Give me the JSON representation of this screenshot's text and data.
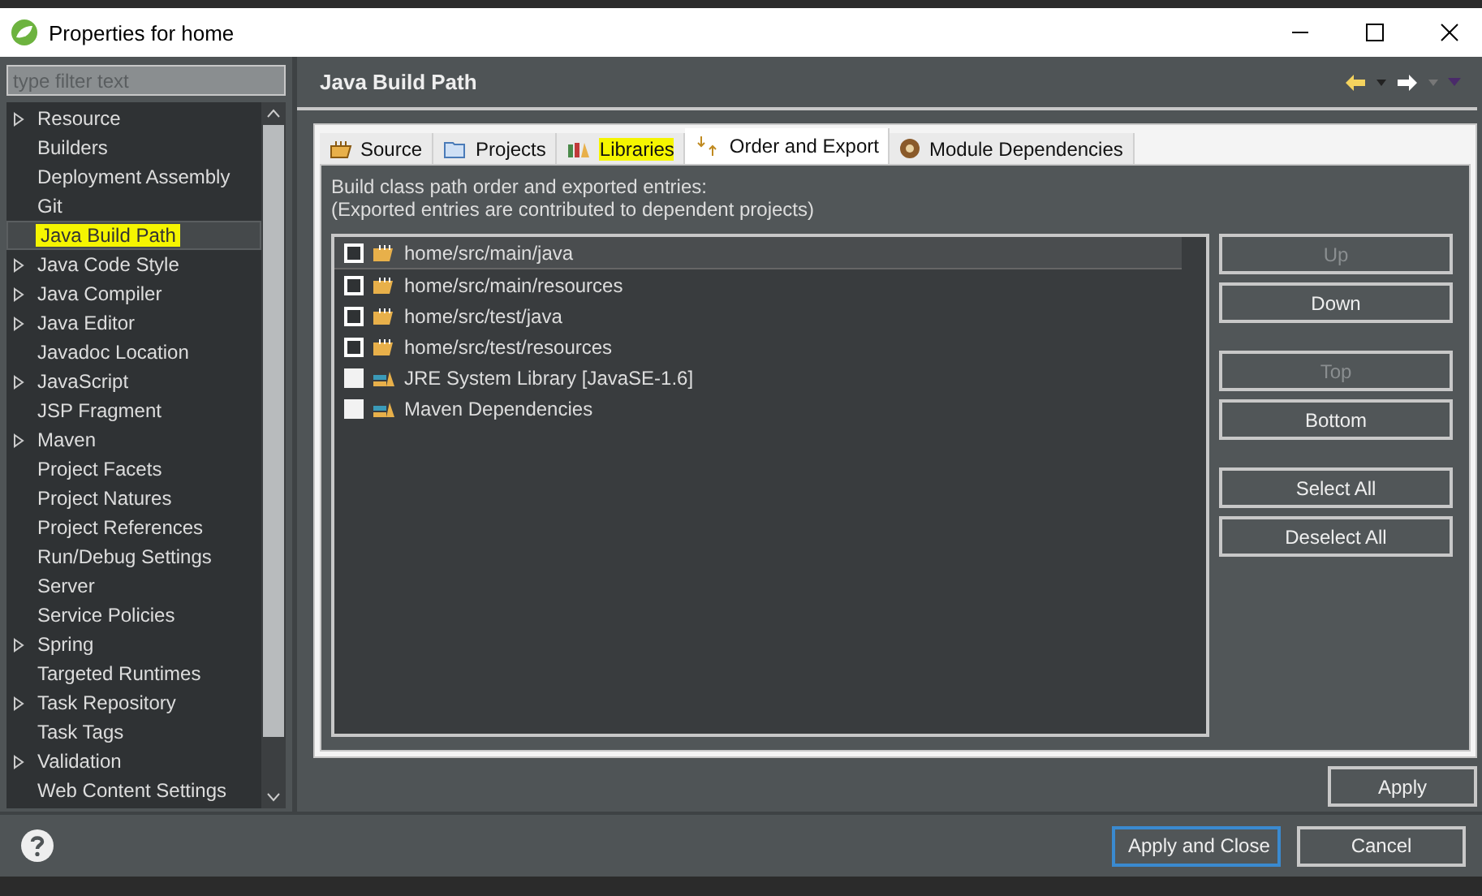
{
  "window": {
    "title": "Properties for home"
  },
  "filter": {
    "placeholder": "type filter text"
  },
  "tree": [
    {
      "label": "Resource",
      "expandable": true,
      "selected": false,
      "highlighted": false
    },
    {
      "label": "Builders",
      "expandable": false,
      "selected": false,
      "highlighted": false
    },
    {
      "label": "Deployment Assembly",
      "expandable": false,
      "selected": false,
      "highlighted": false
    },
    {
      "label": "Git",
      "expandable": false,
      "selected": false,
      "highlighted": false
    },
    {
      "label": "Java Build Path",
      "expandable": false,
      "selected": true,
      "highlighted": true
    },
    {
      "label": "Java Code Style",
      "expandable": true,
      "selected": false,
      "highlighted": false
    },
    {
      "label": "Java Compiler",
      "expandable": true,
      "selected": false,
      "highlighted": false
    },
    {
      "label": "Java Editor",
      "expandable": true,
      "selected": false,
      "highlighted": false
    },
    {
      "label": "Javadoc Location",
      "expandable": false,
      "selected": false,
      "highlighted": false
    },
    {
      "label": "JavaScript",
      "expandable": true,
      "selected": false,
      "highlighted": false
    },
    {
      "label": "JSP Fragment",
      "expandable": false,
      "selected": false,
      "highlighted": false
    },
    {
      "label": "Maven",
      "expandable": true,
      "selected": false,
      "highlighted": false
    },
    {
      "label": "Project Facets",
      "expandable": false,
      "selected": false,
      "highlighted": false
    },
    {
      "label": "Project Natures",
      "expandable": false,
      "selected": false,
      "highlighted": false
    },
    {
      "label": "Project References",
      "expandable": false,
      "selected": false,
      "highlighted": false
    },
    {
      "label": "Run/Debug Settings",
      "expandable": false,
      "selected": false,
      "highlighted": false
    },
    {
      "label": "Server",
      "expandable": false,
      "selected": false,
      "highlighted": false
    },
    {
      "label": "Service Policies",
      "expandable": false,
      "selected": false,
      "highlighted": false
    },
    {
      "label": "Spring",
      "expandable": true,
      "selected": false,
      "highlighted": false
    },
    {
      "label": "Targeted Runtimes",
      "expandable": false,
      "selected": false,
      "highlighted": false
    },
    {
      "label": "Task Repository",
      "expandable": true,
      "selected": false,
      "highlighted": false
    },
    {
      "label": "Task Tags",
      "expandable": false,
      "selected": false,
      "highlighted": false
    },
    {
      "label": "Validation",
      "expandable": true,
      "selected": false,
      "highlighted": false
    },
    {
      "label": "Web Content Settings",
      "expandable": false,
      "selected": false,
      "highlighted": false
    }
  ],
  "page": {
    "title": "Java Build Path"
  },
  "tabs": [
    {
      "label": "Source",
      "kind": "source",
      "selected": false,
      "highlighted": false
    },
    {
      "label": "Projects",
      "kind": "projects",
      "selected": false,
      "highlighted": false
    },
    {
      "label": "Libraries",
      "kind": "libraries",
      "selected": false,
      "highlighted": true
    },
    {
      "label": "Order and Export",
      "kind": "order",
      "selected": true,
      "highlighted": false
    },
    {
      "label": "Module Dependencies",
      "kind": "module",
      "selected": false,
      "highlighted": false
    }
  ],
  "description": [
    "Build class path order and exported entries:",
    "(Exported entries are contributed to dependent projects)"
  ],
  "entries": [
    {
      "label": "home/src/main/java",
      "kind": "folder",
      "checked": false,
      "disabled": false,
      "selected": true
    },
    {
      "label": "home/src/main/resources",
      "kind": "folder",
      "checked": false,
      "disabled": false,
      "selected": false
    },
    {
      "label": "home/src/test/java",
      "kind": "folder",
      "checked": false,
      "disabled": false,
      "selected": false
    },
    {
      "label": "home/src/test/resources",
      "kind": "folder",
      "checked": false,
      "disabled": false,
      "selected": false
    },
    {
      "label": "JRE System Library [JavaSE-1.6]",
      "kind": "library",
      "checked": false,
      "disabled": true,
      "selected": false
    },
    {
      "label": "Maven Dependencies",
      "kind": "library",
      "checked": false,
      "disabled": true,
      "selected": false
    }
  ],
  "side_button_groups": [
    [
      {
        "label": "Up",
        "disabled": true
      },
      {
        "label": "Down",
        "disabled": false
      }
    ],
    [
      {
        "label": "Top",
        "disabled": true
      },
      {
        "label": "Bottom",
        "disabled": false
      }
    ],
    [
      {
        "label": "Select All",
        "disabled": false
      },
      {
        "label": "Deselect All",
        "disabled": false
      }
    ]
  ],
  "apply": "Apply",
  "footer": {
    "primary": "Apply and Close",
    "cancel": "Cancel"
  }
}
